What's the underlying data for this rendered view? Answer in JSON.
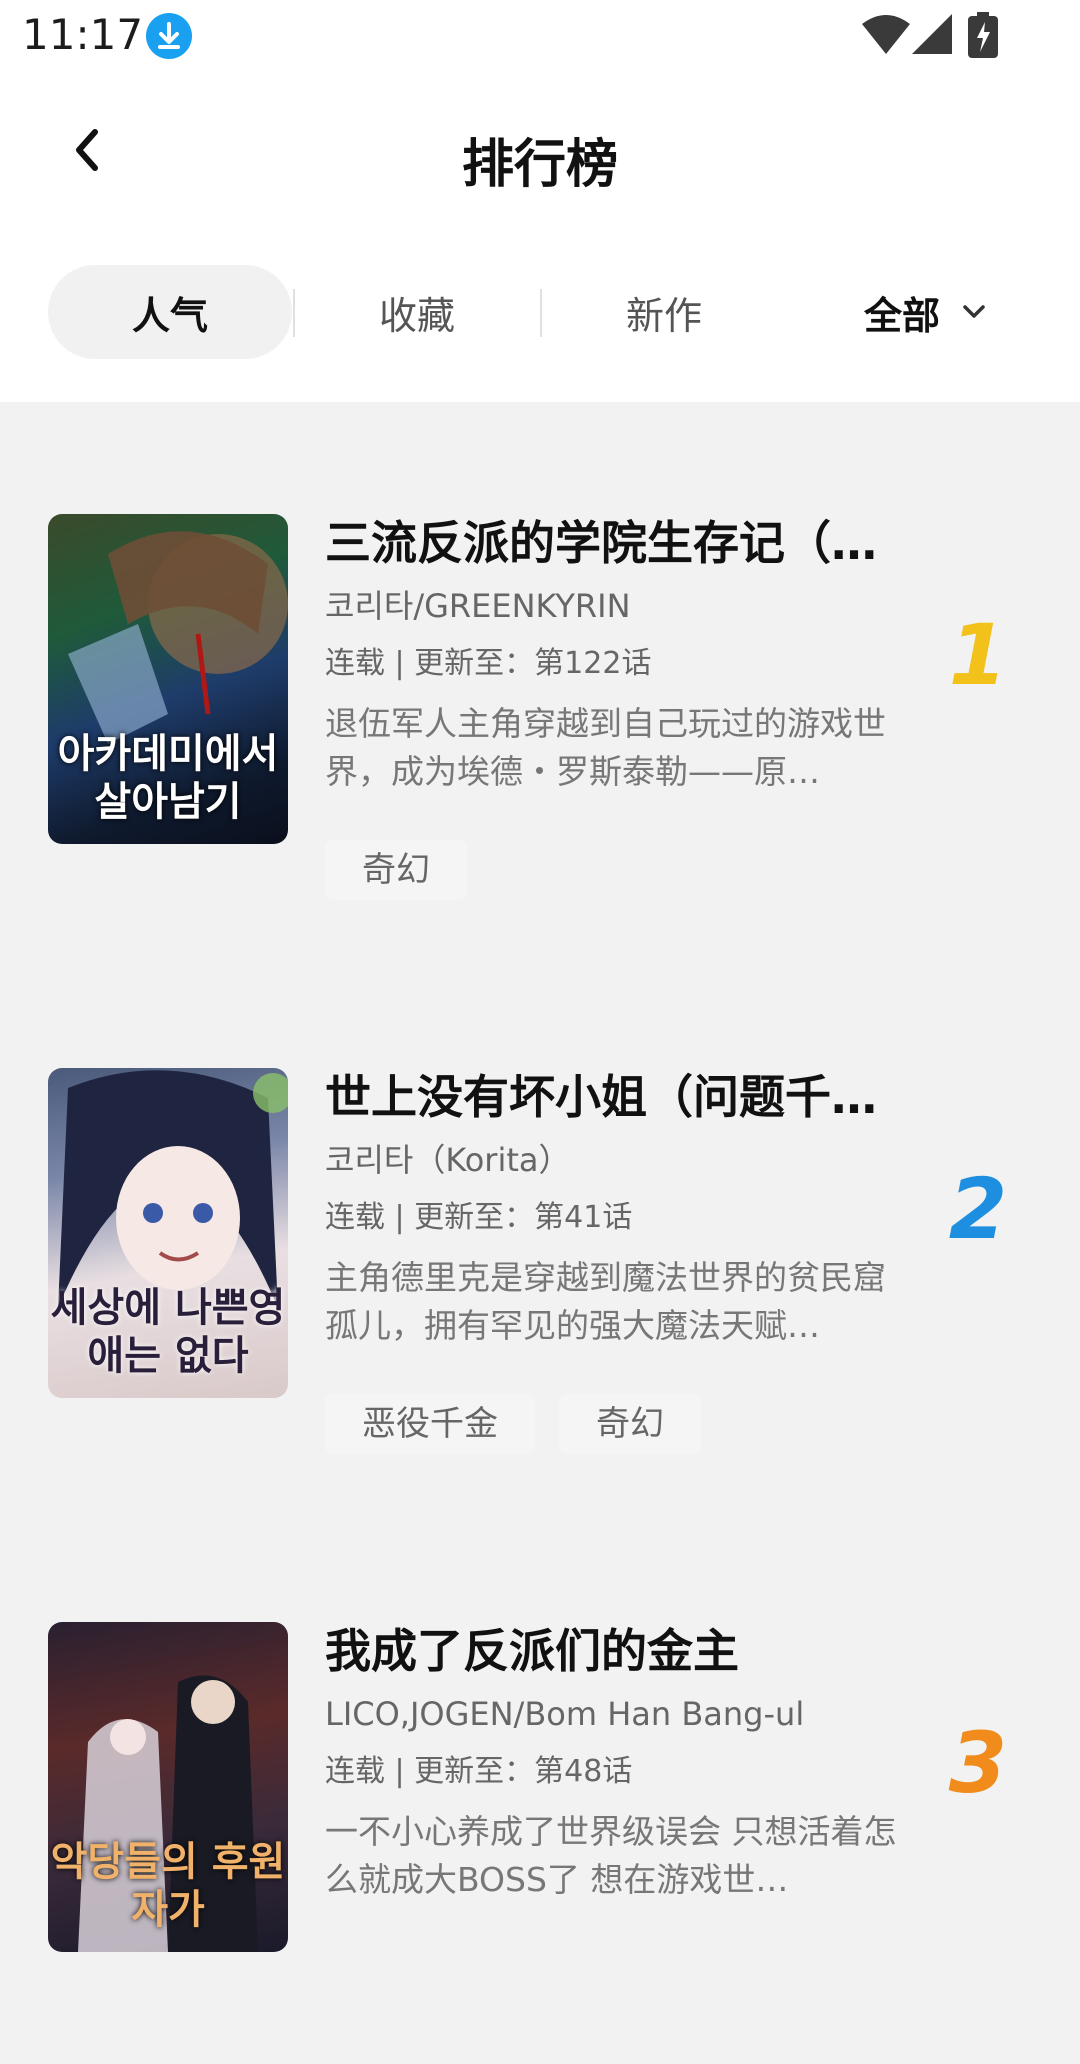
{
  "status_bar": {
    "time": "11:17",
    "icons": [
      "download-icon",
      "wifi-icon",
      "signal-icon",
      "battery-charging-icon"
    ]
  },
  "header": {
    "title": "排行榜",
    "back_icon": "chevron-left-icon"
  },
  "tabs": [
    {
      "label": "人气",
      "active": true
    },
    {
      "label": "收藏",
      "active": false
    },
    {
      "label": "新作",
      "active": false
    }
  ],
  "filter": {
    "label": "全部",
    "icon": "chevron-down-icon"
  },
  "colors": {
    "rank_1": "#f2c21b",
    "rank_2": "#1e8fe0",
    "rank_3": "#f08b1c",
    "background": "#f2f2f2"
  },
  "items": [
    {
      "rank": "1",
      "title": "三流反派的学院生存记（…",
      "author": "코리타/GREENKYRIN",
      "status": "连载 | 更新至：第122话",
      "description": "退伍军人主角穿越到自己玩过的游戏世界，成为埃德・罗斯泰勒——原…",
      "tags": [
        "奇幻"
      ],
      "cover_text": "아카데미에서 살아남기"
    },
    {
      "rank": "2",
      "title": "世上没有坏小姐（问题千…",
      "author": "코리타（Korita）",
      "status": "连载 | 更新至：第41话",
      "description": "主角德里克是穿越到魔法世界的贫民窟孤儿，拥有罕见的强大魔法天赋…",
      "tags": [
        "恶役千金",
        "奇幻"
      ],
      "cover_text": "세상에 나쁜영애는 없다"
    },
    {
      "rank": "3",
      "title": "我成了反派们的金主",
      "author": "LICO,JOGEN/Bom Han Bang-ul",
      "status": "连载 | 更新至：第48话",
      "description": "一不小心养成了世界级误会 只想活着怎么就成大BOSS了 想在游戏世…",
      "tags": [],
      "cover_text": "악당들의 후원자가"
    }
  ]
}
